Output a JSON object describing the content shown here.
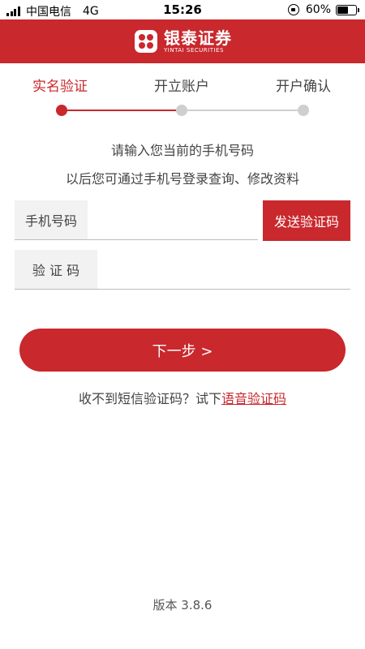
{
  "status_bar": {
    "carrier": "中国电信",
    "network": "4G",
    "time": "15:26",
    "battery": "60%",
    "battery_level": 0.6
  },
  "header": {
    "brand_cn": "银泰证券",
    "brand_en": "YINTAI SECURITIES",
    "color": "#c9282d"
  },
  "steps": {
    "items": [
      {
        "label": "实名验证",
        "active": true
      },
      {
        "label": "开立账户",
        "active": false
      },
      {
        "label": "开户确认",
        "active": false
      }
    ]
  },
  "instructions": {
    "line1": "请输入您当前的手机号码",
    "line2": "以后您可通过手机号登录查询、修改资料"
  },
  "form": {
    "phone_label": "手机号码",
    "phone_value": "",
    "send_code_label": "发送验证码",
    "code_label": "验 证 码",
    "code_value": ""
  },
  "next_button": {
    "label": "下一步 >"
  },
  "hint": {
    "text": "收不到短信验证码？试下",
    "link": "语音验证码"
  },
  "footer": {
    "version": "版本 3.8.6"
  }
}
